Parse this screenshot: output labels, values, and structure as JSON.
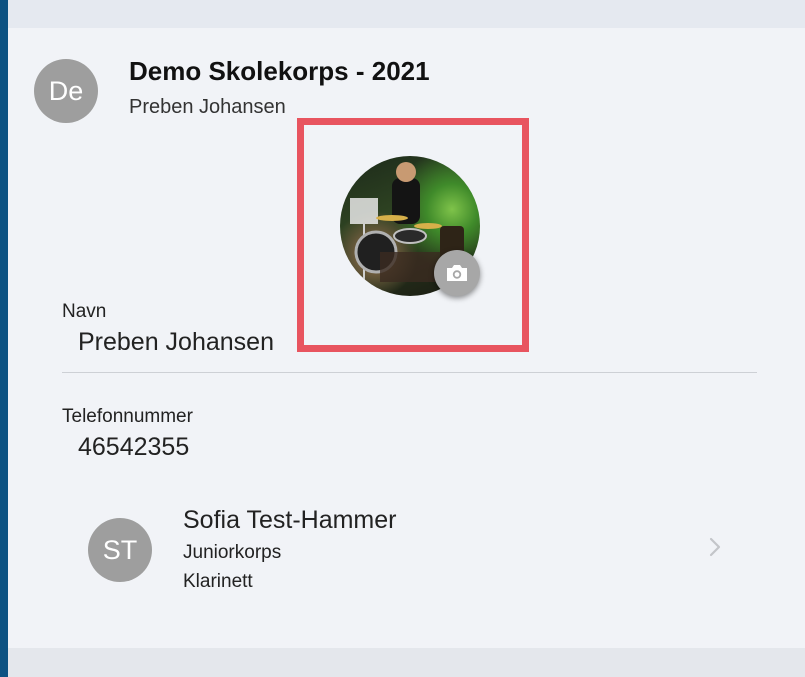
{
  "header": {
    "avatar_initials": "De",
    "title": "Demo Skolekorps - 2021",
    "user_name": "Preben Johansen"
  },
  "profile_photo": {
    "camera_icon": "camera-icon",
    "highlight_color": "#e8545f"
  },
  "fields": {
    "name": {
      "label": "Navn",
      "value": "Preben Johansen"
    },
    "phone": {
      "label": "Telefonnummer",
      "value": "46542355"
    }
  },
  "children": [
    {
      "initials": "ST",
      "name": "Sofia Test-Hammer",
      "group": "Juniorkorps",
      "instrument": "Klarinett",
      "chevron_icon": "chevron-right-icon"
    }
  ],
  "colors": {
    "background": "#0d5282",
    "panel": "#f1f3f7",
    "avatar": "#9e9e9e"
  }
}
